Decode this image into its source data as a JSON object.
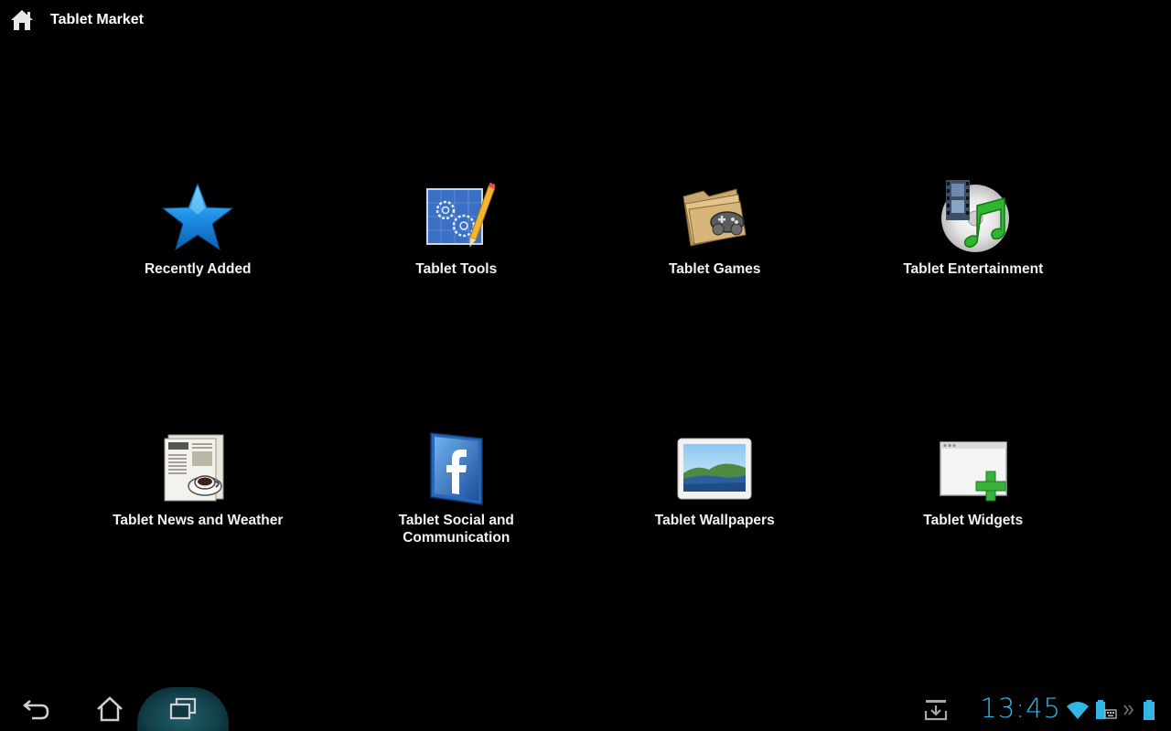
{
  "app": {
    "title": "Tablet Market"
  },
  "categories": [
    {
      "label": "Recently Added",
      "icon": "star-icon"
    },
    {
      "label": "Tablet Tools",
      "icon": "tools-blueprint-icon"
    },
    {
      "label": "Tablet Games",
      "icon": "games-folder-icon"
    },
    {
      "label": "Tablet Entertainment",
      "icon": "entertainment-media-icon"
    },
    {
      "label": "Tablet News and Weather",
      "icon": "newspaper-icon"
    },
    {
      "label": "Tablet Social and Communication",
      "icon": "facebook-icon"
    },
    {
      "label": "Tablet Wallpapers",
      "icon": "wallpaper-picture-icon"
    },
    {
      "label": "Tablet Widgets",
      "icon": "widget-add-icon"
    }
  ],
  "system_bar": {
    "time": "13:45",
    "nav": [
      "back-icon",
      "home-icon",
      "recent-apps-icon"
    ],
    "accent_color": "#33b5e5",
    "status_icons": [
      "download-notification-icon",
      "wifi-icon",
      "keyboard-battery-icon",
      "chevron-icon",
      "battery-icon"
    ]
  }
}
